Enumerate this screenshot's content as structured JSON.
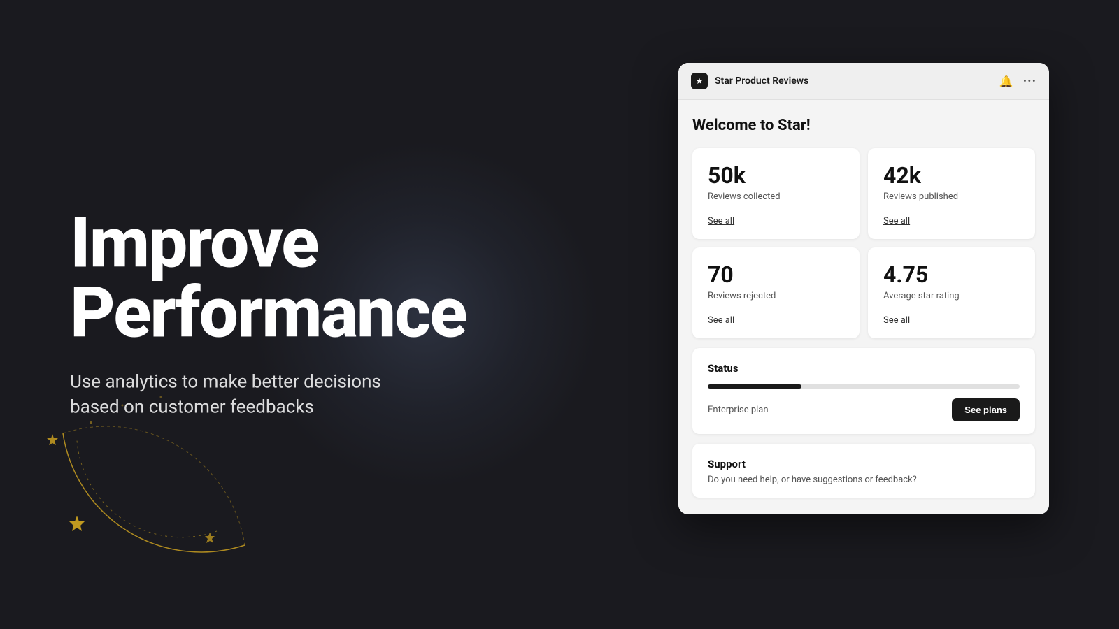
{
  "background": {
    "color": "#1a1a1f"
  },
  "hero": {
    "heading_line1": "Improve",
    "heading_line2": "Performance",
    "subheading": "Use analytics to make better decisions based on customer feedbacks"
  },
  "panel": {
    "title": "Star Product Reviews",
    "welcome": "Welcome to Star!",
    "stats": [
      {
        "value": "50k",
        "label": "Reviews collected",
        "link": "See all"
      },
      {
        "value": "42k",
        "label": "Reviews published",
        "link": "See all"
      },
      {
        "value": "70",
        "label": "Reviews rejected",
        "link": "See all"
      },
      {
        "value": "4.75",
        "label": "Average star rating",
        "link": "See all"
      }
    ],
    "status": {
      "title": "Status",
      "progress_percent": 30,
      "plan_label": "Enterprise plan",
      "see_plans_label": "See plans"
    },
    "support": {
      "title": "Support",
      "text": "Do you need help, or have suggestions or feedback?"
    }
  },
  "icons": {
    "bell": "🔔",
    "more": "···",
    "star_app": "★"
  }
}
